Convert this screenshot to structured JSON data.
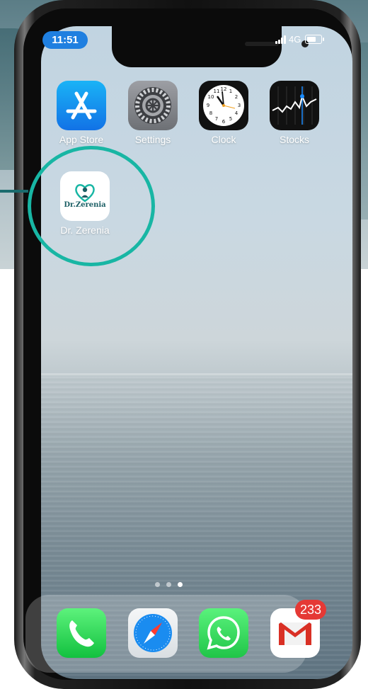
{
  "status_bar": {
    "time": "11:51",
    "network": "4G"
  },
  "home_apps": [
    {
      "label": "App Store",
      "icon": "app-store-icon"
    },
    {
      "label": "Settings",
      "icon": "settings-gear-icon"
    },
    {
      "label": "Clock",
      "icon": "clock-icon"
    },
    {
      "label": "Stocks",
      "icon": "stocks-chart-icon"
    },
    {
      "label": "Dr. Zerenia",
      "icon": "dr-zerenia-logo-icon",
      "logo_text": "Dr.Zerenia"
    }
  ],
  "page_indicator": {
    "pages": 3,
    "current": 3
  },
  "dock": [
    {
      "app": "Phone",
      "icon": "phone-icon"
    },
    {
      "app": "Safari",
      "icon": "safari-compass-icon"
    },
    {
      "app": "WhatsApp",
      "icon": "whatsapp-icon"
    },
    {
      "app": "Gmail",
      "icon": "gmail-icon",
      "badge": "233"
    }
  ],
  "colors": {
    "highlight": "#18b6a4",
    "badge": "#e53935",
    "time_pill": "#1f7fe0"
  }
}
